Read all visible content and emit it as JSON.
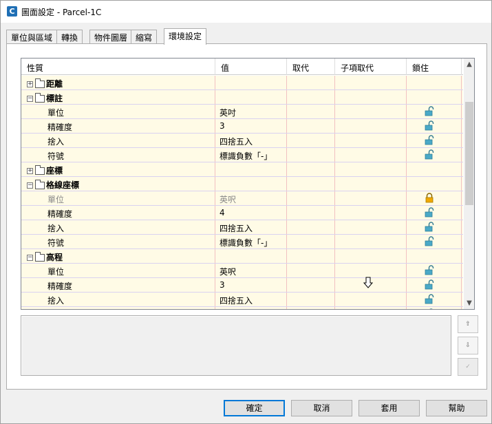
{
  "window": {
    "title": "圖面設定 - Parcel-1C",
    "app_icon_letter": "C"
  },
  "tabs": [
    "單位與區域",
    "轉換",
    "物件圖層",
    "縮寫",
    "環境設定"
  ],
  "grid": {
    "headers": [
      "性質",
      "值",
      "取代",
      "子項取代",
      "鎖住"
    ],
    "rows": [
      {
        "type": "group",
        "expander": "+",
        "label": "距離",
        "value": "",
        "lock": ""
      },
      {
        "type": "group",
        "expander": "−",
        "label": "標註",
        "value": "",
        "lock": ""
      },
      {
        "type": "child",
        "label": "單位",
        "value": "英吋",
        "lock": "unlocked"
      },
      {
        "type": "child",
        "label": "精確度",
        "value": "3",
        "lock": "unlocked"
      },
      {
        "type": "child",
        "label": "捨入",
        "value": "四捨五入",
        "lock": "unlocked"
      },
      {
        "type": "child",
        "label": "符號",
        "value": "標識負數「-」",
        "lock": "unlocked"
      },
      {
        "type": "group",
        "expander": "+",
        "label": "座標",
        "value": "",
        "lock": ""
      },
      {
        "type": "group",
        "expander": "−",
        "label": "格線座標",
        "value": "",
        "lock": ""
      },
      {
        "type": "child",
        "label": "單位",
        "value": "英呎",
        "lock": "locked",
        "dim": true
      },
      {
        "type": "child",
        "label": "精確度",
        "value": "4",
        "lock": "unlocked"
      },
      {
        "type": "child",
        "label": "捨入",
        "value": "四捨五入",
        "lock": "unlocked"
      },
      {
        "type": "child",
        "label": "符號",
        "value": "標識負數「-」",
        "lock": "unlocked"
      },
      {
        "type": "group",
        "expander": "−",
        "label": "高程",
        "value": "",
        "lock": ""
      },
      {
        "type": "child",
        "label": "單位",
        "value": "英呎",
        "lock": "unlocked"
      },
      {
        "type": "child",
        "label": "精確度",
        "value": "3",
        "lock": "unlocked"
      },
      {
        "type": "child",
        "label": "捨入",
        "value": "四捨五入",
        "lock": "unlocked"
      },
      {
        "type": "child",
        "label": "",
        "value": "",
        "lock": "unlocked"
      }
    ]
  },
  "buttons": {
    "ok": "確定",
    "cancel": "取消",
    "apply": "套用",
    "help": "幫助"
  },
  "icons": {
    "app": "civil3d-icon",
    "expand": "plus-icon",
    "collapse": "minus-icon",
    "lock_open": "unlock-icon",
    "lock_closed": "lock-icon",
    "move_up": "move-up-icon",
    "move_down": "move-down-icon",
    "checkbox": "checkbox-icon"
  },
  "colors": {
    "row_bg": "#fffbe6",
    "row_border": "#d9d2f0",
    "unlocked": "#4aa9c7",
    "locked": "#f0a800",
    "default_button": "#0078d7"
  }
}
